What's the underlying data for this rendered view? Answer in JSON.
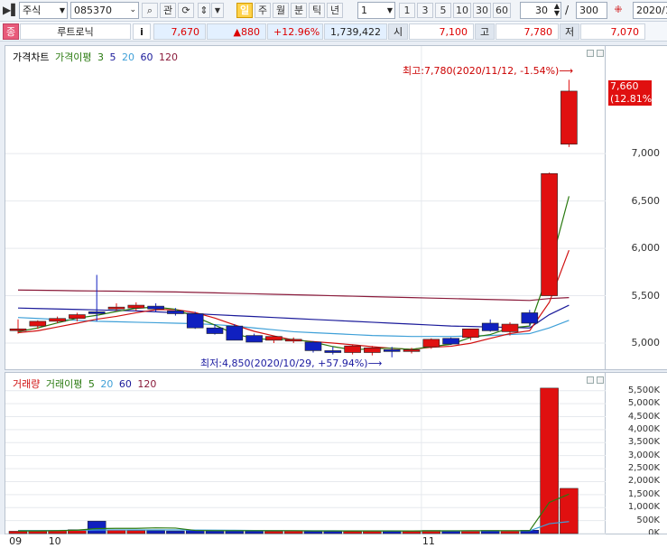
{
  "toolbar": {
    "market": "주식",
    "code": "085370",
    "gwan_label": "관",
    "periods": [
      "일",
      "주",
      "월",
      "분",
      "틱",
      "년"
    ],
    "period_selected": "일",
    "multiplier": "1",
    "intervals": [
      "1",
      "3",
      "5",
      "10",
      "30",
      "60"
    ],
    "count": "30",
    "total": "300",
    "date": "2020/1"
  },
  "infobar": {
    "prefix": "종",
    "name": "루트로닉",
    "info_btn": "i",
    "price": "7,670",
    "change": "▲880",
    "change_pct": "+12.96%",
    "volume": "1,739,422",
    "open_label": "시",
    "open": "7,100",
    "high_label": "고",
    "high": "7,780",
    "low_label": "저",
    "low": "7,070"
  },
  "price_legend": {
    "title": "가격차트",
    "ma_label": "가격이평",
    "ma_periods": [
      "3",
      "5",
      "20",
      "60",
      "120"
    ]
  },
  "volume_legend": {
    "title": "거래량",
    "ma_label": "거래이평",
    "ma_periods": [
      "5",
      "20",
      "60",
      "120"
    ]
  },
  "annotations": {
    "high_note": "최고:7,780(2020/11/12, -1.54%)",
    "low_note": "최저:4,850(2020/10/29, +57.94%)",
    "last_price": "7,660",
    "last_pct": "(12.81%)"
  },
  "colors": {
    "up": "#e01010",
    "down": "#1020c0",
    "ma3": "#2a7a10",
    "ma5": "#d01010",
    "ma20": "#3fa0d8",
    "ma60": "#1a1a9a",
    "ma120": "#8a1a3a"
  },
  "x_labels": [
    {
      "text": "09",
      "idx": 0
    },
    {
      "text": "10",
      "idx": 2
    },
    {
      "text": "11",
      "idx": 21
    }
  ],
  "chart_data": [
    {
      "type": "candlestick",
      "ylim": [
        4800,
        7850
      ],
      "yticks": [
        5000,
        5500,
        6000,
        6500,
        7000
      ],
      "candles": [
        {
          "o": 5150,
          "h": 5250,
          "l": 5100,
          "c": 5150
        },
        {
          "o": 5180,
          "h": 5240,
          "l": 5150,
          "c": 5230
        },
        {
          "o": 5230,
          "h": 5280,
          "l": 5210,
          "c": 5260
        },
        {
          "o": 5260,
          "h": 5320,
          "l": 5230,
          "c": 5300
        },
        {
          "o": 5330,
          "h": 5720,
          "l": 5230,
          "c": 5320
        },
        {
          "o": 5360,
          "h": 5420,
          "l": 5340,
          "c": 5380
        },
        {
          "o": 5370,
          "h": 5430,
          "l": 5340,
          "c": 5400
        },
        {
          "o": 5390,
          "h": 5420,
          "l": 5330,
          "c": 5360
        },
        {
          "o": 5340,
          "h": 5370,
          "l": 5290,
          "c": 5310
        },
        {
          "o": 5310,
          "h": 5330,
          "l": 5150,
          "c": 5160
        },
        {
          "o": 5160,
          "h": 5200,
          "l": 5090,
          "c": 5100
        },
        {
          "o": 5180,
          "h": 5200,
          "l": 5030,
          "c": 5030
        },
        {
          "o": 5080,
          "h": 5100,
          "l": 5010,
          "c": 5010
        },
        {
          "o": 5030,
          "h": 5080,
          "l": 5000,
          "c": 5070
        },
        {
          "o": 5040,
          "h": 5060,
          "l": 5000,
          "c": 5040
        },
        {
          "o": 5010,
          "h": 5020,
          "l": 4900,
          "c": 4920
        },
        {
          "o": 4920,
          "h": 4960,
          "l": 4880,
          "c": 4900
        },
        {
          "o": 4900,
          "h": 4980,
          "l": 4880,
          "c": 4970
        },
        {
          "o": 4900,
          "h": 4970,
          "l": 4870,
          "c": 4950
        },
        {
          "o": 4930,
          "h": 4960,
          "l": 4850,
          "c": 4920
        },
        {
          "o": 4920,
          "h": 4950,
          "l": 4890,
          "c": 4930
        },
        {
          "o": 4960,
          "h": 5050,
          "l": 4940,
          "c": 5040
        },
        {
          "o": 5050,
          "h": 5060,
          "l": 4980,
          "c": 4990
        },
        {
          "o": 5060,
          "h": 5150,
          "l": 5030,
          "c": 5150
        },
        {
          "o": 5210,
          "h": 5250,
          "l": 5120,
          "c": 5130
        },
        {
          "o": 5120,
          "h": 5220,
          "l": 5080,
          "c": 5200
        },
        {
          "o": 5320,
          "h": 5350,
          "l": 5180,
          "c": 5210
        },
        {
          "o": 5500,
          "h": 6800,
          "l": 5500,
          "c": 6790
        },
        {
          "o": 7100,
          "h": 7780,
          "l": 7070,
          "c": 7660
        }
      ],
      "ma3": [
        5120,
        5160,
        5213,
        5263,
        5293,
        5333,
        5367,
        5380,
        5357,
        5277,
        5190,
        5097,
        5047,
        5037,
        5040,
        5010,
        4963,
        4930,
        4940,
        4947,
        4933,
        4963,
        4987,
        5060,
        5090,
        5160,
        5180,
        5770,
        6550
      ],
      "ma5": [
        5110,
        5130,
        5170,
        5210,
        5252,
        5282,
        5320,
        5352,
        5354,
        5322,
        5264,
        5192,
        5124,
        5076,
        5032,
        5016,
        5000,
        4982,
        4962,
        4944,
        4934,
        4956,
        4966,
        4998,
        5050,
        5100,
        5130,
        5430,
        5980
      ],
      "ma20": [
        5270,
        5260,
        5250,
        5240,
        5230,
        5225,
        5220,
        5215,
        5210,
        5205,
        5195,
        5180,
        5160,
        5140,
        5120,
        5110,
        5100,
        5090,
        5080,
        5075,
        5070,
        5070,
        5070,
        5075,
        5080,
        5090,
        5100,
        5160,
        5240
      ],
      "ma60": [
        5370,
        5365,
        5360,
        5355,
        5350,
        5345,
        5340,
        5330,
        5320,
        5310,
        5300,
        5290,
        5280,
        5270,
        5260,
        5250,
        5240,
        5230,
        5220,
        5210,
        5200,
        5190,
        5180,
        5175,
        5170,
        5165,
        5160,
        5300,
        5400
      ],
      "ma120": [
        5560,
        5558,
        5555,
        5552,
        5550,
        5548,
        5545,
        5542,
        5540,
        5535,
        5530,
        5525,
        5520,
        5515,
        5510,
        5505,
        5500,
        5495,
        5490,
        5485,
        5480,
        5475,
        5470,
        5465,
        5460,
        5455,
        5450,
        5470,
        5480
      ]
    },
    {
      "type": "bar",
      "ylim": [
        0,
        5700000
      ],
      "yticks_labels": [
        "0K",
        "500K",
        "1,000K",
        "1,500K",
        "2,000K",
        "2,500K",
        "3,000K",
        "3,500K",
        "4,000K",
        "4,500K",
        "5,000K",
        "5,500K"
      ],
      "yticks": [
        0,
        500000,
        1000000,
        1500000,
        2000000,
        2500000,
        3000000,
        3500000,
        4000000,
        4500000,
        5000000,
        5500000
      ],
      "values": [
        90000,
        110000,
        120000,
        150000,
        480000,
        140000,
        120000,
        110000,
        100000,
        130000,
        110000,
        120000,
        100000,
        90000,
        100000,
        110000,
        100000,
        90000,
        100000,
        110000,
        90000,
        120000,
        100000,
        110000,
        120000,
        100000,
        130000,
        5600000,
        1740000
      ],
      "ma5": [
        100000,
        100000,
        110000,
        130000,
        190000,
        200000,
        200000,
        220000,
        210000,
        120000,
        110000,
        110000,
        110000,
        110000,
        110000,
        100000,
        100000,
        100000,
        100000,
        100000,
        100000,
        105000,
        105000,
        110000,
        110000,
        110000,
        110000,
        1200000,
        1520000
      ],
      "ma20": [
        120000,
        120000,
        120000,
        125000,
        140000,
        140000,
        140000,
        140000,
        140000,
        135000,
        130000,
        125000,
        120000,
        115000,
        110000,
        110000,
        108000,
        106000,
        105000,
        104000,
        102000,
        103000,
        104000,
        105000,
        106000,
        106000,
        108000,
        380000,
        460000
      ]
    }
  ]
}
